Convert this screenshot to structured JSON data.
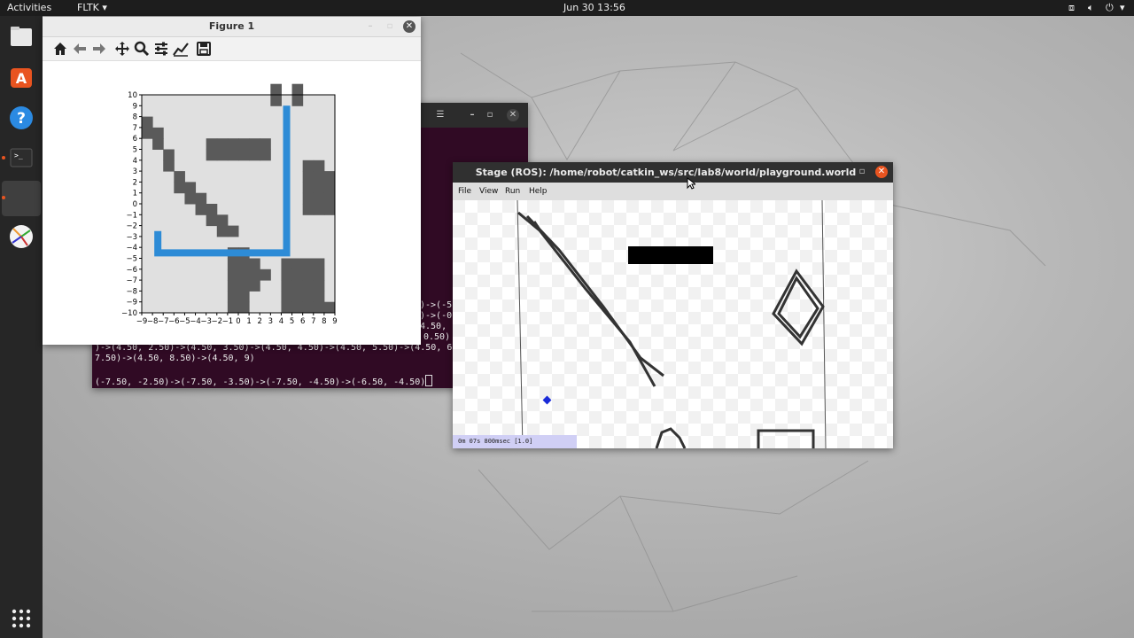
{
  "topbar": {
    "activities": "Activities",
    "app_menu": "FLTK",
    "clock": "Jun 30  13:56"
  },
  "dock": {
    "items": [
      "files-icon",
      "software-icon",
      "help-icon",
      "terminal-icon",
      "active-app",
      "stage-icon"
    ],
    "apps_grid": "show-applications-icon"
  },
  "terminal": {
    "title": "",
    "lines": [
      ")->(-5",
      ")->(-0",
      "4.50,",
      "0.50)",
      ")->(4.50, 2.50)->(4.50, 3.50)->(4.50, 4.50)->(4.50, 5.50)->(4.50, 6",
      "7.50)->(4.50, 8.50)->(4.50, 9)",
      "",
      "(-7.50, -2.50)->(-7.50, -3.50)->(-7.50, -4.50)->(-6.50, -4.50)"
    ]
  },
  "figure": {
    "title": "Figure 1",
    "toolbar": [
      "home-icon",
      "back-icon",
      "forward-icon",
      "pan-icon",
      "zoom-icon",
      "configure-icon",
      "edit-axis-icon",
      "save-icon"
    ]
  },
  "chart_data": {
    "type": "heatmap",
    "title": "",
    "xlabel": "",
    "ylabel": "",
    "xlim": [
      -9,
      9
    ],
    "ylim": [
      -10,
      10
    ],
    "x_ticks": [
      "−9",
      "−8",
      "−7",
      "−6",
      "−5",
      "−4",
      "−3",
      "−2",
      "−1",
      "0",
      "1",
      "2",
      "3",
      "4",
      "5",
      "6",
      "7",
      "8",
      "9"
    ],
    "y_ticks": [
      "10",
      "9",
      "8",
      "7",
      "6",
      "5",
      "4",
      "3",
      "2",
      "1",
      "0",
      "−1",
      "−2",
      "−3",
      "−4",
      "−5",
      "−6",
      "−7",
      "−8",
      "−9",
      "−10"
    ],
    "background_color": "#e0e0e0",
    "obstacle_color": "#5a5a5a",
    "path_color": "#2d8bd6",
    "obstacles": [
      [
        3,
        10
      ],
      [
        3,
        9
      ],
      [
        5,
        10
      ],
      [
        5,
        9
      ],
      [
        -9,
        7
      ],
      [
        -9,
        6
      ],
      [
        -8,
        6
      ],
      [
        -8,
        5
      ],
      [
        -7,
        4
      ],
      [
        -7,
        3
      ],
      [
        -6,
        2
      ],
      [
        -6,
        1
      ],
      [
        -5,
        1
      ],
      [
        -5,
        0
      ],
      [
        -4,
        0
      ],
      [
        -4,
        -1
      ],
      [
        -3,
        -1
      ],
      [
        -3,
        -2
      ],
      [
        -2,
        -2
      ],
      [
        -2,
        -3
      ],
      [
        -1,
        -3
      ],
      [
        -3,
        5
      ],
      [
        -2,
        5
      ],
      [
        -1,
        5
      ],
      [
        0,
        5
      ],
      [
        1,
        5
      ],
      [
        2,
        5
      ],
      [
        -3,
        4
      ],
      [
        -2,
        4
      ],
      [
        -1,
        4
      ],
      [
        0,
        4
      ],
      [
        1,
        4
      ],
      [
        2,
        4
      ],
      [
        6,
        3
      ],
      [
        7,
        3
      ],
      [
        6,
        2
      ],
      [
        7,
        2
      ],
      [
        8,
        2
      ],
      [
        6,
        1
      ],
      [
        7,
        1
      ],
      [
        8,
        1
      ],
      [
        6,
        0
      ],
      [
        7,
        0
      ],
      [
        8,
        0
      ],
      [
        6,
        -1
      ],
      [
        7,
        -1
      ],
      [
        8,
        -1
      ],
      [
        -1,
        -5
      ],
      [
        0,
        -5
      ],
      [
        -1,
        -6
      ],
      [
        0,
        -6
      ],
      [
        1,
        -6
      ],
      [
        -1,
        -7
      ],
      [
        0,
        -7
      ],
      [
        1,
        -7
      ],
      [
        2,
        -7
      ],
      [
        -1,
        -8
      ],
      [
        0,
        -8
      ],
      [
        1,
        -8
      ],
      [
        -1,
        -9
      ],
      [
        0,
        -9
      ],
      [
        -1,
        -10
      ],
      [
        0,
        -10
      ],
      [
        4,
        -6
      ],
      [
        5,
        -6
      ],
      [
        6,
        -6
      ],
      [
        7,
        -6
      ],
      [
        4,
        -7
      ],
      [
        5,
        -7
      ],
      [
        6,
        -7
      ],
      [
        7,
        -7
      ],
      [
        4,
        -8
      ],
      [
        5,
        -8
      ],
      [
        6,
        -8
      ],
      [
        7,
        -8
      ],
      [
        4,
        -9
      ],
      [
        5,
        -9
      ],
      [
        6,
        -9
      ],
      [
        7,
        -9
      ],
      [
        4,
        -10
      ],
      [
        5,
        -10
      ],
      [
        6,
        -10
      ],
      [
        7,
        -10
      ],
      [
        8,
        -10
      ]
    ],
    "path": [
      [
        -7.5,
        -2.5
      ],
      [
        -7.5,
        -3.5
      ],
      [
        -7.5,
        -4.5
      ],
      [
        -6.5,
        -4.5
      ],
      [
        -5.5,
        -4.5
      ],
      [
        -4.5,
        -4.5
      ],
      [
        -3.5,
        -4.5
      ],
      [
        -2.5,
        -4.5
      ],
      [
        -1.5,
        -4.5
      ],
      [
        -0.5,
        -4.5
      ],
      [
        0.5,
        -4.5
      ],
      [
        1.5,
        -4.5
      ],
      [
        2.5,
        -4.5
      ],
      [
        3.5,
        -4.5
      ],
      [
        4.5,
        -4.5
      ],
      [
        4.5,
        -3.5
      ],
      [
        4.5,
        -2.5
      ],
      [
        4.5,
        -1.5
      ],
      [
        4.5,
        -0.5
      ],
      [
        4.5,
        0.5
      ],
      [
        4.5,
        1.5
      ],
      [
        4.5,
        2.5
      ],
      [
        4.5,
        3.5
      ],
      [
        4.5,
        4.5
      ],
      [
        4.5,
        5.5
      ],
      [
        4.5,
        6.5
      ],
      [
        4.5,
        7.5
      ],
      [
        4.5,
        8.5
      ],
      [
        4.5,
        9
      ]
    ]
  },
  "stage": {
    "title": "Stage (ROS): /home/robot/catkin_ws/src/lab8/world/playground.world",
    "menu": [
      "File",
      "View",
      "Run",
      "Help"
    ],
    "status": "0m 07s 800msec [1.0]",
    "robot_color": "#1a2bd8"
  }
}
